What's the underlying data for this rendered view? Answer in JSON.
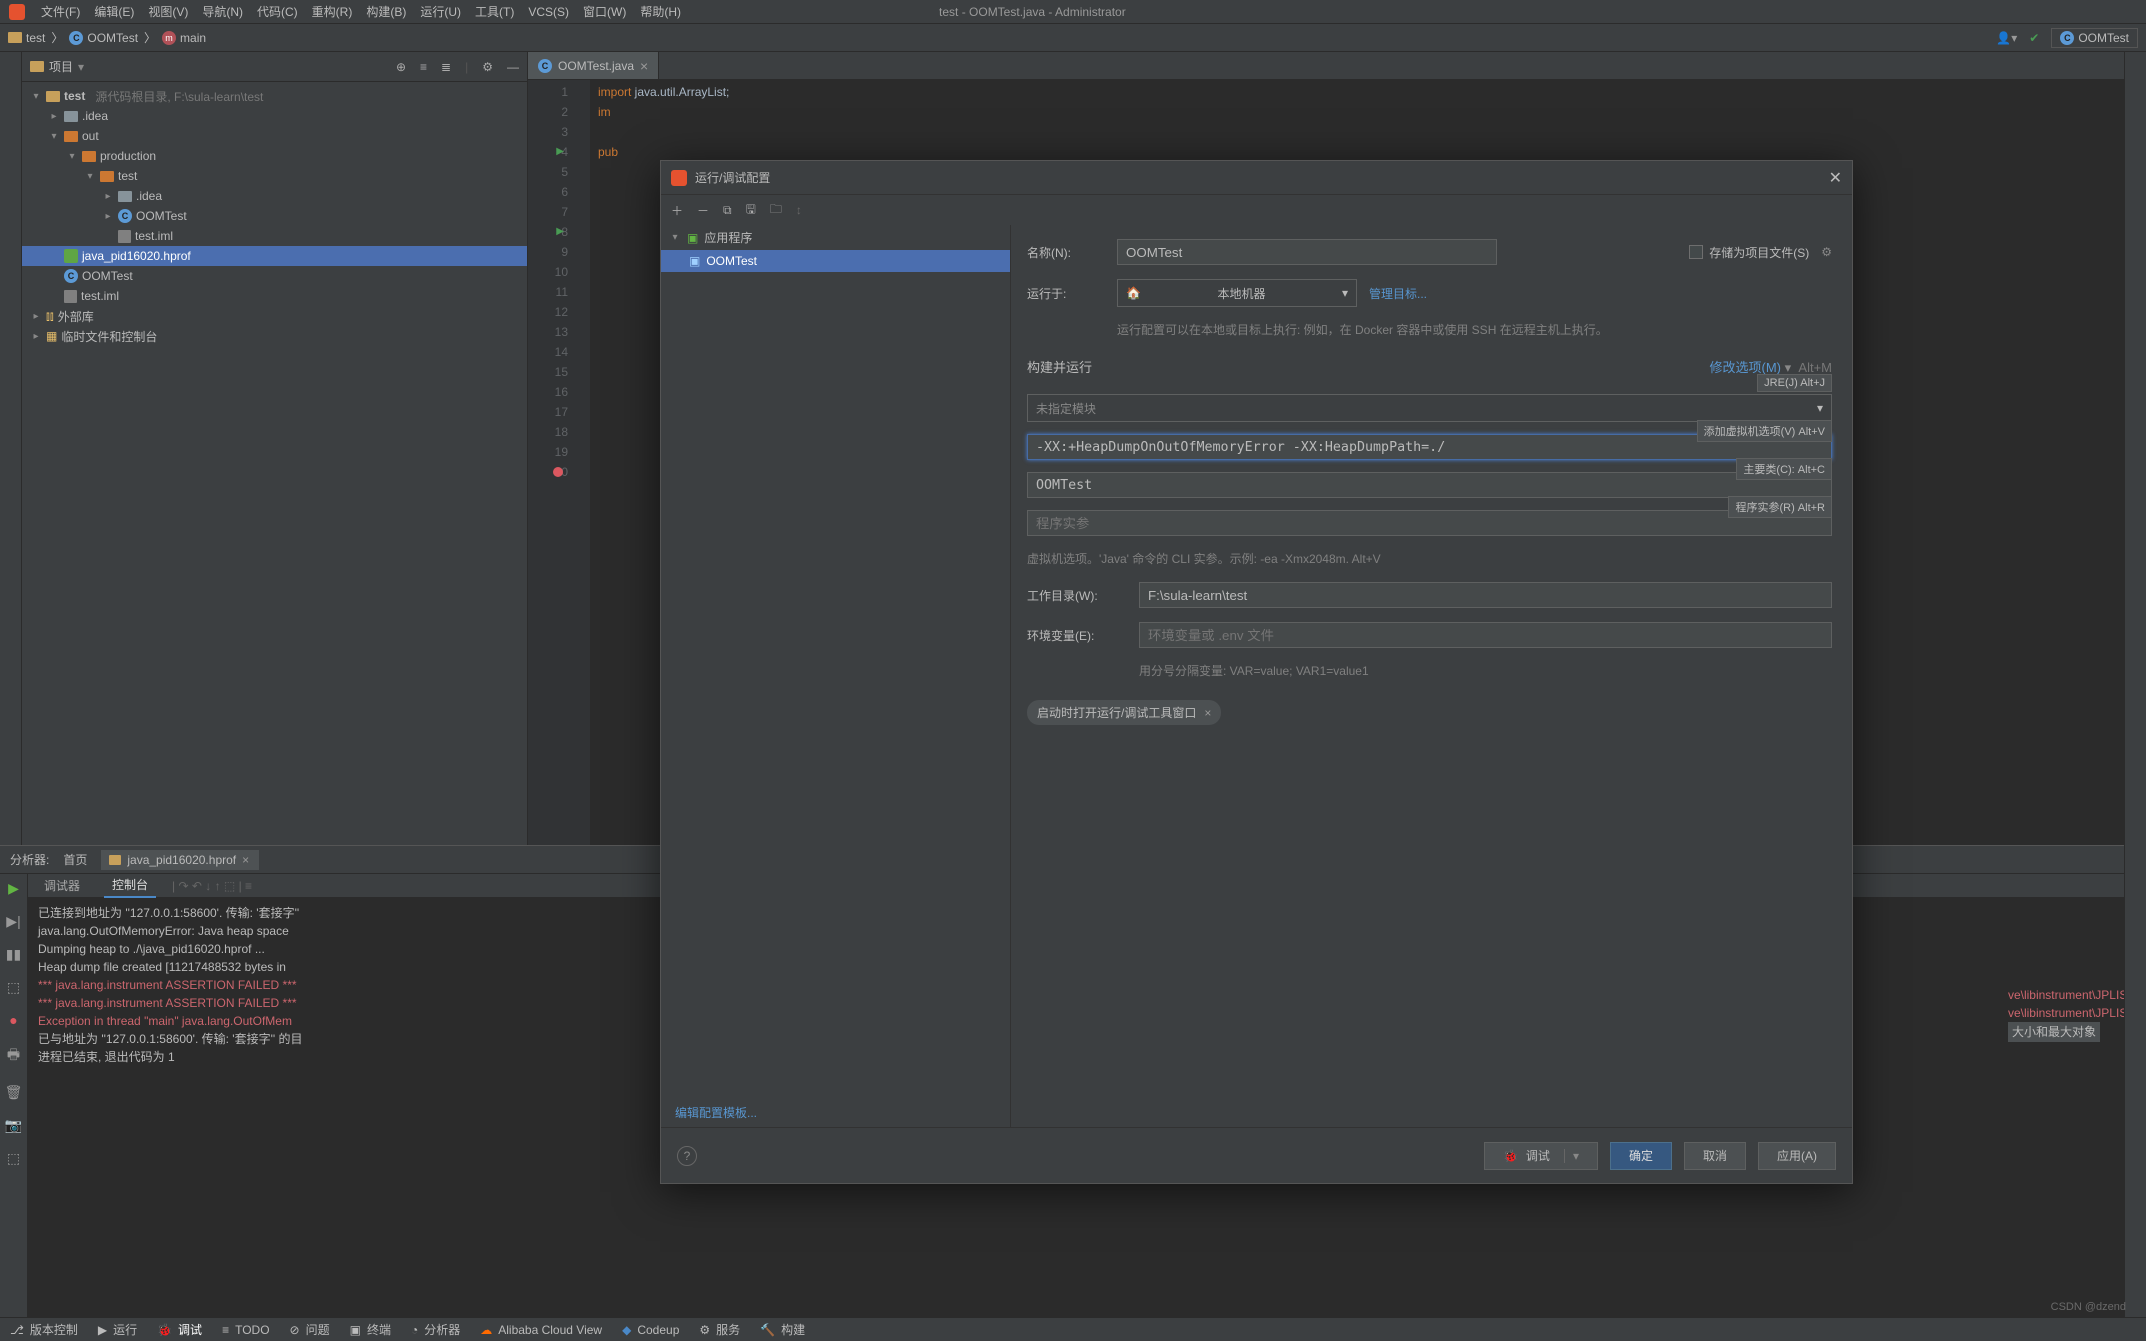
{
  "menu": {
    "items": [
      "文件(F)",
      "编辑(E)",
      "视图(V)",
      "导航(N)",
      "代码(C)",
      "重构(R)",
      "构建(B)",
      "运行(U)",
      "工具(T)",
      "VCS(S)",
      "窗口(W)",
      "帮助(H)"
    ],
    "window_title": "test - OOMTest.java - Administrator"
  },
  "breadcrumbs": {
    "project": "test",
    "classname": "OOMTest",
    "method": "main",
    "nav_right": "OOMTest"
  },
  "project_panel": {
    "title": "项目",
    "tree_root": "test",
    "tree_root_hint": "源代码根目录, F:\\sula-learn\\test",
    "items": {
      "idea": ".idea",
      "out": "out",
      "production": "production",
      "testdir": "test",
      "idea2": ".idea",
      "oomtest_cls": "OOMTest",
      "test_iml": "test.iml",
      "hprof": "java_pid16020.hprof",
      "oomtest2": "OOMTest",
      "test_iml2": "test.iml",
      "external": "外部库",
      "scratch": "临时文件和控制台"
    }
  },
  "editor": {
    "tab": "OOMTest.java",
    "lines": {
      "l1": "import java.util.ArrayList;",
      "l2": "imp",
      "l4": "pub"
    }
  },
  "analyzer": {
    "label": "分析器:",
    "home": "首页",
    "tab": "java_pid16020.hprof"
  },
  "debug": {
    "tabs": {
      "t1": "调试器",
      "t2": "控制台"
    },
    "lines": [
      "已连接到地址为 ''127.0.0.1:58600'. 传输: '套接字''",
      "java.lang.OutOfMemoryError: Java heap space",
      "Dumping heap to ./\\java_pid16020.hprof ...",
      "Heap dump file created [11217488532 bytes in ",
      "*** java.lang.instrument ASSERTION FAILED ***",
      "*** java.lang.instrument ASSERTION FAILED ***",
      "Exception in thread \"main\" java.lang.OutOfMem",
      "已与地址为 ''127.0.0.1:58600'. 传输: '套接字'' 的目",
      "",
      "进程已结束, 退出代码为 1"
    ],
    "right_frag1": "ve\\libinstrument\\JPLISAg",
    "right_frag2": "ve\\libinstrument\\JPLISAg",
    "right_frag3": "大小和最大对象"
  },
  "statusbar": {
    "vcs": "版本控制",
    "run": "运行",
    "debug": "调试",
    "todo": "TODO",
    "problems": "问题",
    "terminal": "终端",
    "profiler": "分析器",
    "cloud": "Alibaba Cloud View",
    "codeup": "Codeup",
    "services": "服务",
    "build": "构建"
  },
  "dialog": {
    "title": "运行/调试配置",
    "sidebar": {
      "category": "应用程序",
      "item": "OOMTest"
    },
    "form": {
      "name_label": "名称(N):",
      "name_value": "OOMTest",
      "store_label": "存储为项目文件(S)",
      "runon_label": "运行于:",
      "runon_value": "本地机器",
      "manage": "管理目标...",
      "runon_hint": "运行配置可以在本地或目标上执行: 例如，在 Docker 容器中或使用 SSH 在远程主机上执行。",
      "build_title": "构建并运行",
      "modify_opts": "修改选项(M)",
      "modify_short": "Alt+M",
      "jre_tip": "JRE(J) Alt+J",
      "module_placeholder": "未指定模块",
      "vmopts_tip": "添加虚拟机选项(V) Alt+V",
      "vmopts_value": "-XX:+HeapDumpOnOutOfMemoryError -XX:HeapDumpPath=./",
      "main_tip": "主要类(C): Alt+C",
      "main_value": "OOMTest",
      "args_tip": "程序实参(R) Alt+R",
      "args_placeholder": "程序实参",
      "vm_hint": "虚拟机选项。'Java' 命令的 CLI 实参。示例: -ea -Xmx2048m. Alt+V",
      "wd_label": "工作目录(W):",
      "wd_value": "F:\\sula-learn\\test",
      "env_label": "环境变量(E):",
      "env_placeholder": "环境变量或 .env 文件",
      "env_hint": "用分号分隔变量: VAR=value; VAR1=value1",
      "chip": "启动时打开运行/调试工具窗口"
    },
    "template_link": "编辑配置模板...",
    "footer": {
      "debug": "调试",
      "ok": "确定",
      "cancel": "取消",
      "apply": "应用(A)"
    }
  },
  "watermark": "CSDN @dzend"
}
